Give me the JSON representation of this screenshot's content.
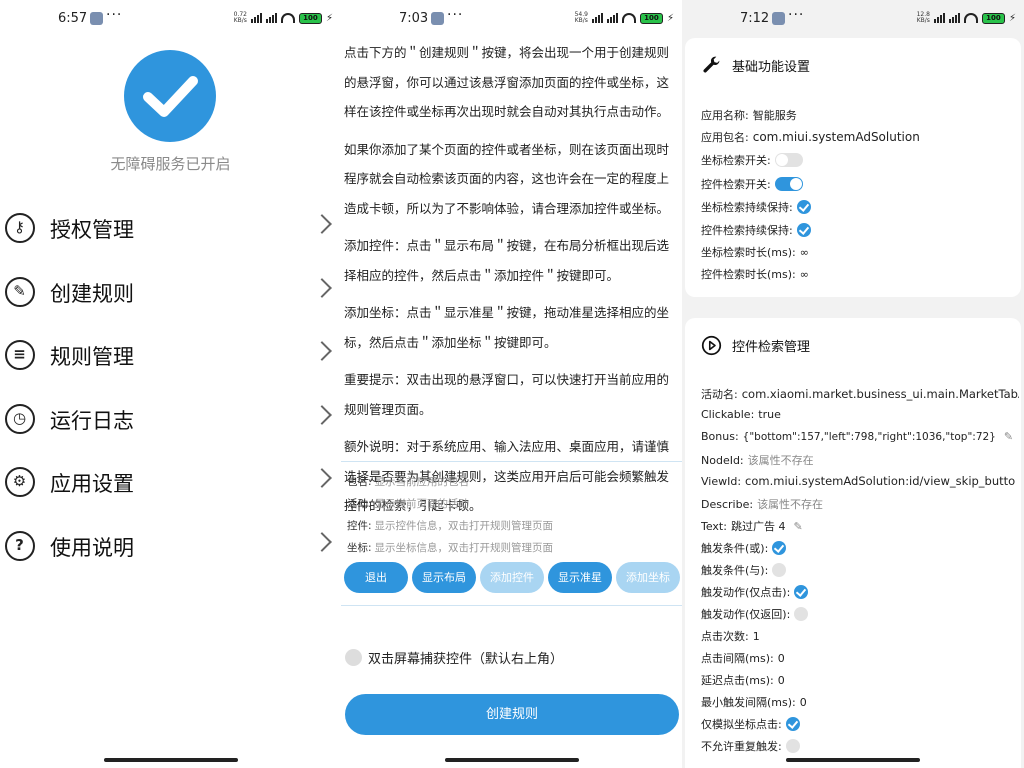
{
  "status_bars": [
    {
      "time": "6:57",
      "speed": "0.72\nKB/s",
      "battery": "100"
    },
    {
      "time": "7:03",
      "speed": "54.9\nKB/s",
      "battery": "100"
    },
    {
      "time": "7:12",
      "speed": "12.8\nKB/s",
      "battery": "100"
    }
  ],
  "panel1": {
    "status_text": "无障碍服务已开启",
    "menu": [
      {
        "label": "授权管理",
        "icon": "key-icon"
      },
      {
        "label": "创建规则",
        "icon": "pencil-icon"
      },
      {
        "label": "规则管理",
        "icon": "database-icon"
      },
      {
        "label": "运行日志",
        "icon": "clock-icon"
      },
      {
        "label": "应用设置",
        "icon": "gear-icon"
      },
      {
        "label": "使用说明",
        "icon": "help-icon"
      }
    ]
  },
  "panel2": {
    "paragraphs": [
      "点击下方的＂创建规则＂按键，将会出现一个用于创建规则的悬浮窗，你可以通过该悬浮窗添加页面的控件或坐标，这样在该控件或坐标再次出现时就会自动对其执行点击动作。",
      "如果你添加了某个页面的控件或者坐标，则在该页面出现时程序就会自动检索该页面的内容，这也许会在一定的程度上造成卡顿，所以为了不影响体验，请合理添加控件或坐标。",
      "添加控件：点击＂显示布局＂按键，在布局分析框出现后选择相应的控件，然后点击＂添加控件＂按键即可。",
      "添加坐标：点击＂显示准星＂按键，拖动准星选择相应的坐标，然后点击＂添加坐标＂按键即可。",
      "重要提示：双击出现的悬浮窗口，可以快速打开当前应用的规则管理页面。",
      "额外说明：对于系统应用、输入法应用、桌面应用，请谨慎选择是否要为其创建规则，这类应用开启后可能会频繁触发控件的检索，引起卡顿。"
    ],
    "float_rows": [
      {
        "key": "包名:",
        "hint": "显示当前应用的包名"
      },
      {
        "key": "活动:",
        "hint": "显示当前页面的活动"
      },
      {
        "key": "控件:",
        "hint": "显示控件信息，双击打开规则管理页面"
      },
      {
        "key": "坐标:",
        "hint": "显示坐标信息，双击打开规则管理页面"
      }
    ],
    "buttons": [
      {
        "label": "退出",
        "enabled": true
      },
      {
        "label": "显示布局",
        "enabled": true
      },
      {
        "label": "添加控件",
        "enabled": false
      },
      {
        "label": "显示准星",
        "enabled": true
      },
      {
        "label": "添加坐标",
        "enabled": false
      }
    ],
    "double_tap_label": "双击屏幕捕获控件（默认右上角）",
    "create_button": "创建规则"
  },
  "panel3": {
    "card1": {
      "title": "基础功能设置",
      "app_name_key": "应用名称:",
      "app_name": "智能服务",
      "pkg_key": "应用包名:",
      "pkg": "com.miui.systemAdSolution",
      "coord_switch": "坐标检索开关:",
      "widget_switch": "控件检索开关:",
      "coord_keep": "坐标检索持续保持:",
      "widget_keep": "控件检索持续保持:",
      "coord_dur_key": "坐标检索时长(ms):",
      "coord_dur": "∞",
      "widget_dur_key": "控件检索时长(ms):",
      "widget_dur": "∞"
    },
    "card2": {
      "title": "控件检索管理",
      "activity_key": "活动名:",
      "activity": "com.xiaomi.market.business_ui.main.MarketTabActiv",
      "clickable_key": "Clickable:",
      "clickable": "true",
      "bonus_key": "Bonus:",
      "bonus": "{\"bottom\":157,\"left\":798,\"right\":1036,\"top\":72}",
      "nodeid_key": "NodeId:",
      "nodeid": "该属性不存在",
      "viewid_key": "ViewId:",
      "viewid": "com.miui.systemAdSolution:id/view_skip_butto",
      "describe_key": "Describe:",
      "describe": "该属性不存在",
      "text_key": "Text:",
      "text": "跳过广告 4",
      "trigger_or": "触发条件(或):",
      "trigger_and": "触发条件(与):",
      "action_click": "触发动作(仅点击):",
      "action_back": "触发动作(仅返回):",
      "click_count_key": "点击次数:",
      "click_count": "1",
      "click_interval_key": "点击间隔(ms):",
      "click_interval": "0",
      "delay_key": "延迟点击(ms):",
      "delay": "0",
      "min_trigger_key": "最小触发间隔(ms):",
      "min_trigger": "0",
      "simulate_key": "仅模拟坐标点击:",
      "no_repeat_key": "不允许重复触发:"
    }
  }
}
